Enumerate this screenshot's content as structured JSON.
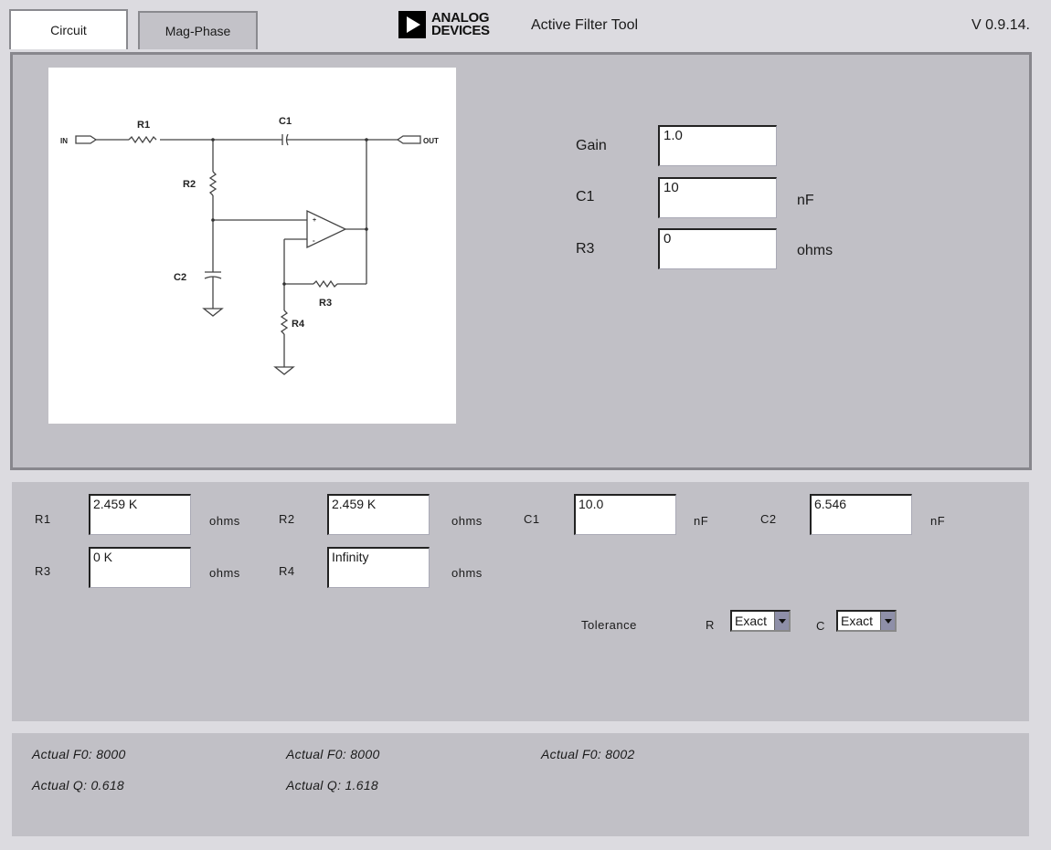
{
  "tabs": [
    {
      "label": "Circuit",
      "active": true
    },
    {
      "label": "Mag-Phase",
      "active": false
    }
  ],
  "header": {
    "logo_line1": "ANALOG",
    "logo_line2": "DEVICES",
    "title": "Active Filter Tool",
    "version": "V 0.9.14."
  },
  "schematic": {
    "labels": {
      "in": "IN",
      "out": "OUT",
      "r1": "R1",
      "r2": "R2",
      "r3": "R3",
      "r4": "R4",
      "c1": "C1",
      "c2": "C2"
    }
  },
  "design_inputs": [
    {
      "label": "Gain",
      "value": "1.0",
      "unit": ""
    },
    {
      "label": "C1",
      "value": "10",
      "unit": "nF"
    },
    {
      "label": "R3",
      "value": "0",
      "unit": "ohms"
    }
  ],
  "components": {
    "r1": {
      "label": "R1",
      "value": "2.459 K",
      "unit": "ohms"
    },
    "r2": {
      "label": "R2",
      "value": "2.459 K",
      "unit": "ohms"
    },
    "c1": {
      "label": "C1",
      "value": "10.0",
      "unit": "nF"
    },
    "c2": {
      "label": "C2",
      "value": "6.546",
      "unit": "nF"
    },
    "r3": {
      "label": "R3",
      "value": "0 K",
      "unit": "ohms"
    },
    "r4": {
      "label": "R4",
      "value": "Infinity",
      "unit": "ohms"
    }
  },
  "tolerance": {
    "label": "Tolerance",
    "r_label": "R",
    "r_value": "Exact",
    "c_label": "C",
    "c_value": "Exact"
  },
  "results": {
    "col1_f0": "Actual F0: 8000",
    "col1_q": "Actual Q: 0.618",
    "col2_f0": "Actual F0: 8000",
    "col2_q": "Actual Q: 1.618",
    "col3_f0": "Actual F0: 8002"
  }
}
